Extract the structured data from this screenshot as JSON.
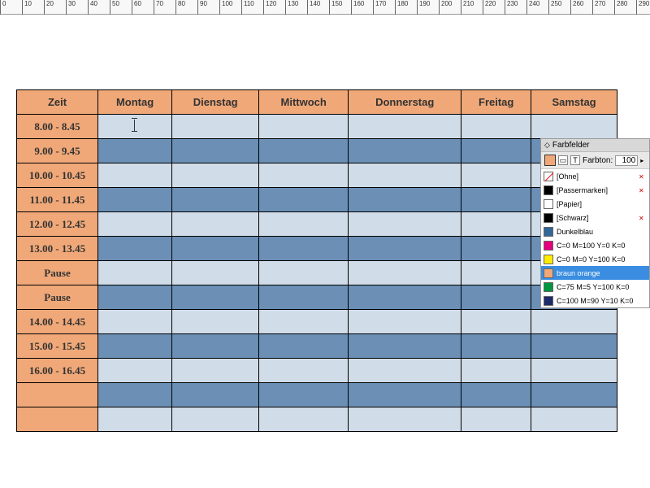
{
  "ruler": {
    "max": 290,
    "step": 10
  },
  "schedule": {
    "header": [
      "Zeit",
      "Montag",
      "Dienstag",
      "Mittwoch",
      "Donnerstag",
      "Freitag",
      "Samstag"
    ],
    "rows": [
      "8.00 - 8.45",
      "9.00 - 9.45",
      "10.00 - 10.45",
      "11.00 - 11.45",
      "12.00 - 12.45",
      "13.00 - 13.45",
      "Pause",
      "Pause",
      "14.00 - 14.45",
      "15.00 - 15.45",
      "16.00 - 16.45",
      "",
      ""
    ]
  },
  "swatches_panel": {
    "title": "Farbfelder",
    "farbton_label": "Farbton:",
    "farbton_value": "100",
    "colors": {
      "toolbar_fill": "#f0a878",
      "passermarken": "#000000",
      "papier": "#ffffff",
      "schwarz": "#000000",
      "dunkelblau": "#336699",
      "magenta": "#e6007e",
      "yellow": "#ffed00",
      "braun_orange": "#f0a878",
      "green": "#009640",
      "navy": "#1d2b6b"
    },
    "items": [
      {
        "label": "[Ohne]",
        "type": "none",
        "deletable": true
      },
      {
        "label": "[Passermarken]",
        "color_key": "passermarken",
        "deletable": true
      },
      {
        "label": "[Papier]",
        "color_key": "papier"
      },
      {
        "label": "[Schwarz]",
        "color_key": "schwarz",
        "deletable": true
      },
      {
        "label": "Dunkelblau",
        "color_key": "dunkelblau"
      },
      {
        "label": "C=0 M=100 Y=0 K=0",
        "color_key": "magenta"
      },
      {
        "label": "C=0 M=0 Y=100 K=0",
        "color_key": "yellow"
      },
      {
        "label": "braun orange",
        "color_key": "braun_orange",
        "selected": true
      },
      {
        "label": "C=75 M=5 Y=100 K=0",
        "color_key": "green"
      },
      {
        "label": "C=100 M=90 Y=10 K=0",
        "color_key": "navy"
      }
    ]
  }
}
